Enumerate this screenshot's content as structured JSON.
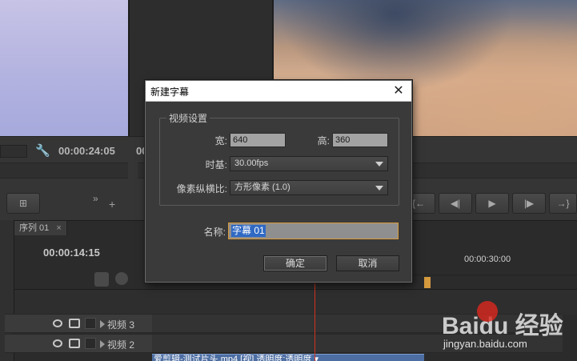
{
  "source_monitor": {
    "timecode": "00:00:24:05"
  },
  "program_monitor": {
    "timecode_partial": "00"
  },
  "timeline": {
    "tab_label": "序列 01",
    "timecode": "00:00:14:15",
    "ruler_time": "00:00:30:00",
    "tracks": [
      {
        "label": "视频 3"
      },
      {
        "label": "视频 2"
      }
    ],
    "clip_label": "爱剪辑-测试片头.mp4 [视] 透明度:透明度 ▾"
  },
  "dialog": {
    "title": "新建字幕",
    "close_label": "✕",
    "group_title": "视频设置",
    "width_label": "宽:",
    "width_value": "640",
    "height_label": "高:",
    "height_value": "360",
    "timebase_label": "时基:",
    "timebase_value": "30.00fps",
    "par_label": "像素纵横比:",
    "par_value": "方形像素 (1.0)",
    "name_label": "名称:",
    "name_value": "字幕 01",
    "ok_label": "确定",
    "cancel_label": "取消"
  },
  "watermark": {
    "brand": "Baidu 经验",
    "url": "jingyan.baidu.com"
  },
  "colors": {
    "accent_orange": "#d99a3a",
    "selection_blue": "#2f69c4",
    "playhead_red": "#d0321e"
  }
}
